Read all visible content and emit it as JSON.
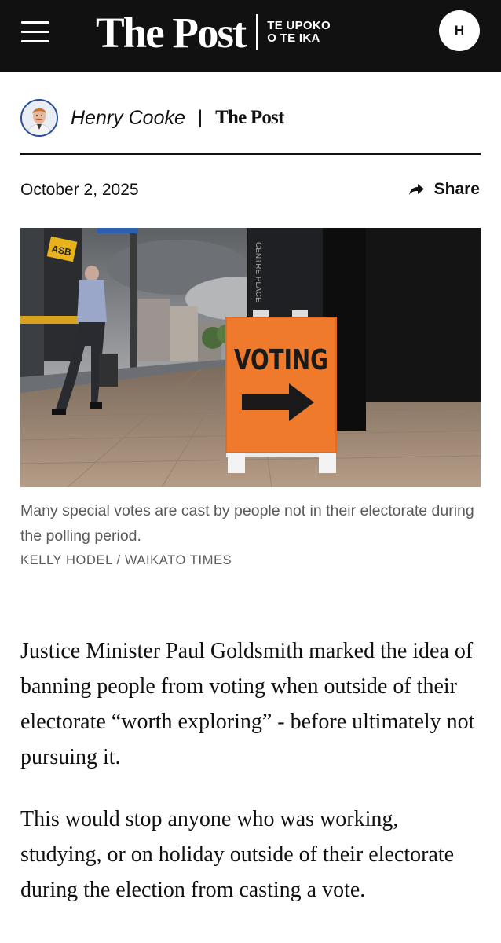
{
  "header": {
    "brand": "The Post",
    "sub_line1": "TE UPOKO",
    "sub_line2": "O TE IKA",
    "account_initial": "H"
  },
  "byline": {
    "author": "Henry Cooke",
    "separator": "|",
    "publication": "The Post"
  },
  "meta": {
    "date": "October 2, 2025",
    "share_label": "Share"
  },
  "photo": {
    "sign_text": "VOTING",
    "street_sign": "CENTRE PLACE",
    "building_sign": "ASB",
    "caption": "Many special votes are cast by people not in their electorate during the polling period.",
    "credit": "KELLY HODEL / WAIKATO TIMES"
  },
  "article": {
    "paragraphs": [
      "Justice Minister Paul Goldsmith marked the idea of banning people from voting when outside of their electorate “worth exploring” - before ultimately not pursuing it.",
      "This would stop anyone who was working, studying, or on holiday outside of their electorate during the election from casting a vote."
    ]
  },
  "colors": {
    "header_bg": "#111111",
    "sign_orange": "#f07a2c",
    "avatar_ring": "#2a4f9c",
    "caption_text": "#5a5a5a"
  },
  "icons": {
    "menu": "hamburger-icon",
    "share": "share-arrow-icon"
  }
}
